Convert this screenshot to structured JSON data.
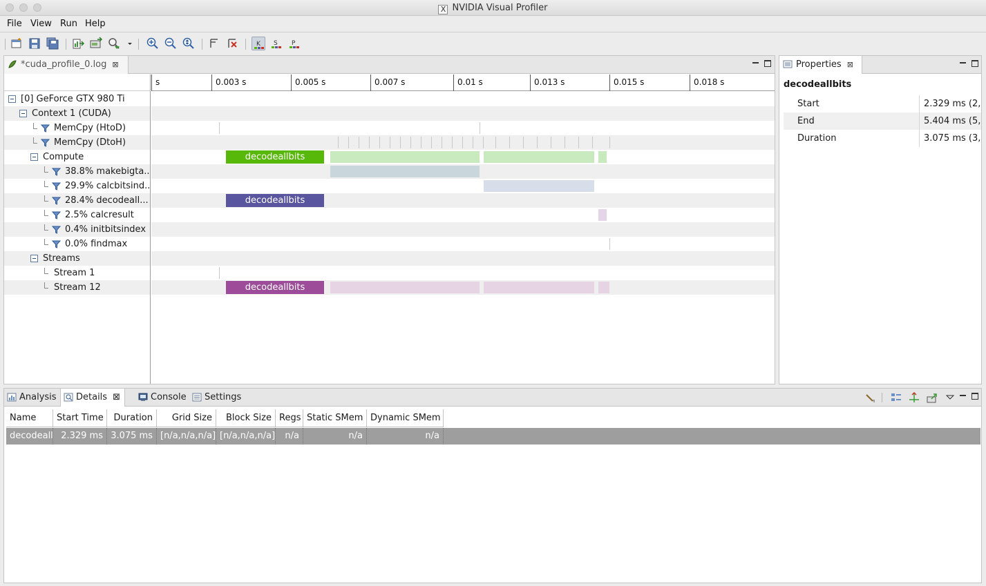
{
  "window": {
    "title": "NVIDIA Visual Profiler"
  },
  "menu": [
    "File",
    "View",
    "Run",
    "Help"
  ],
  "editor": {
    "tab_label": "*cuda_profile_0.log",
    "ruler_ticks": [
      "s",
      "0.003 s",
      "0.005 s",
      "0.007 s",
      "0.01 s",
      "0.013 s",
      "0.015 s",
      "0.018 s"
    ],
    "tree": [
      {
        "label": "[0] GeForce GTX 980 Ti"
      },
      {
        "label": "Context 1 (CUDA)"
      },
      {
        "label": "MemCpy (HtoD)"
      },
      {
        "label": "MemCpy (DtoH)"
      },
      {
        "label": "Compute"
      },
      {
        "label": "38.8% makebigta..."
      },
      {
        "label": "29.9% calcbitsind..."
      },
      {
        "label": "28.4% decodeall..."
      },
      {
        "label": "2.5% calcresult"
      },
      {
        "label": "0.4% initbitsindex"
      },
      {
        "label": "0.0% findmax"
      },
      {
        "label": "Streams"
      },
      {
        "label": "Stream 1"
      },
      {
        "label": "Stream 12"
      }
    ],
    "kernel_label": "decodeallbits",
    "colors": {
      "compute": "#58b809",
      "decode": "#5a559f",
      "stream": "#9d4c9a",
      "makebig": "#c9d6dc",
      "calcbits": "#d7dde9",
      "calcresult": "#e4d6e8",
      "compute_light": "#c9e9be",
      "stream_light": "#e6d3e3"
    }
  },
  "properties": {
    "tab_label": "Properties",
    "title": "decodeallbits",
    "rows": [
      {
        "key": "Start",
        "value": "2.329 ms (2,"
      },
      {
        "key": "End",
        "value": "5.404 ms (5,"
      },
      {
        "key": "Duration",
        "value": "3.075 ms (3,"
      }
    ]
  },
  "bottom": {
    "tabs": [
      "Analysis",
      "Details",
      "Console",
      "Settings"
    ],
    "columns": [
      "Name",
      "Start Time",
      "Duration",
      "Grid Size",
      "Block Size",
      "Regs",
      "Static SMem",
      "Dynamic SMem"
    ],
    "row": [
      "decodeall",
      "2.329 ms",
      "3.075 ms",
      "[n/a,n/a,n/a]",
      "[n/a,n/a,n/a]",
      "n/a",
      "n/a",
      "n/a"
    ]
  }
}
